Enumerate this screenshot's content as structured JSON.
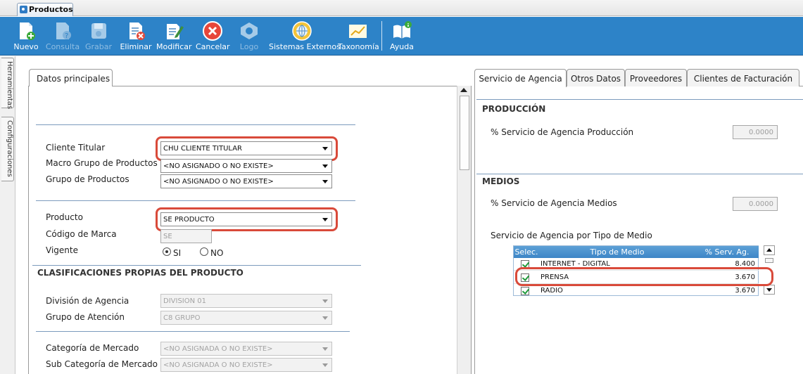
{
  "window": {
    "tab_label": "Productos"
  },
  "toolbar": {
    "buttons": [
      {
        "label": "Nuevo",
        "icon": "new-document-icon",
        "enabled": true
      },
      {
        "label": "Consulta",
        "icon": "query-document-icon",
        "enabled": false
      },
      {
        "label": "Grabar",
        "icon": "save-disk-icon",
        "enabled": false
      },
      {
        "label": "Eliminar",
        "icon": "delete-document-icon",
        "enabled": true
      },
      {
        "label": "Modificar",
        "icon": "edit-document-icon",
        "enabled": true
      },
      {
        "label": "Cancelar",
        "icon": "cancel-icon",
        "enabled": true
      },
      {
        "label": "Logo",
        "icon": "logo-icon",
        "enabled": false
      },
      {
        "label": "Sistemas Externos",
        "icon": "globe-icon",
        "enabled": true
      },
      {
        "label": "Taxonomía",
        "icon": "chart-icon",
        "enabled": true
      },
      {
        "label": "Ayuda",
        "icon": "help-book-icon",
        "enabled": true
      }
    ]
  },
  "side_tabs": [
    "Herramientas",
    "Configuraciones"
  ],
  "left": {
    "tab": "Datos principales",
    "fields": {
      "cliente_titular": {
        "label": "Cliente Titular",
        "value": "CHU CLIENTE TITULAR"
      },
      "macro_grupo": {
        "label": "Macro Grupo de Productos",
        "value": "<NO ASIGNADO O NO EXISTE>"
      },
      "grupo": {
        "label": "Grupo de Productos",
        "value": "<NO ASIGNADO O NO EXISTE>"
      },
      "producto": {
        "label": "Producto",
        "value": "SE PRODUCTO"
      },
      "codigo_marca": {
        "label": "Código de Marca",
        "value": "SE"
      },
      "vigente": {
        "label": "Vigente",
        "options": [
          "SI",
          "NO"
        ],
        "selected": "SI"
      }
    },
    "clasificaciones": {
      "title": "CLASIFICACIONES PROPIAS DEL PRODUCTO",
      "division": {
        "label": "División de Agencia",
        "value": "DIVISION 01"
      },
      "grupo_atencion": {
        "label": "Grupo de Atención",
        "value": "C8 GRUPO"
      },
      "categoria": {
        "label": "Categoría de Mercado",
        "value": "<NO ASIGNADA O NO EXISTE>"
      },
      "sub_categoria": {
        "label": "Sub Categoría de Mercado",
        "value": "<NO ASIGNADA O NO EXISTE>"
      }
    }
  },
  "right": {
    "tabs": [
      "Servicio de Agencia",
      "Otros Datos",
      "Proveedores",
      "Clientes de Facturación"
    ],
    "active_tab": "Servicio de Agencia",
    "produccion": {
      "title": "PRODUCCIÓN",
      "label": "% Servicio de Agencia Producción",
      "value": "0.0000"
    },
    "medios": {
      "title": "MEDIOS",
      "label": "% Servicio de Agencia Medios",
      "value": "0.0000"
    },
    "tipo_medio": {
      "title": "Servicio de Agencia por Tipo de Medio",
      "columns": [
        "Selec.",
        "Tipo de Medio",
        "% Serv. Ag."
      ],
      "rows": [
        {
          "checked": true,
          "tipo": "INTERNET - DIGITAL",
          "pct": "8.400"
        },
        {
          "checked": true,
          "tipo": "PRENSA",
          "pct": "3.670"
        },
        {
          "checked": true,
          "tipo": "RADIO",
          "pct": "3.670"
        }
      ]
    }
  },
  "colors": {
    "toolbar_bg": "#2d83c8",
    "highlight": "#d94a3a",
    "grid_header": "#3d86c7"
  }
}
